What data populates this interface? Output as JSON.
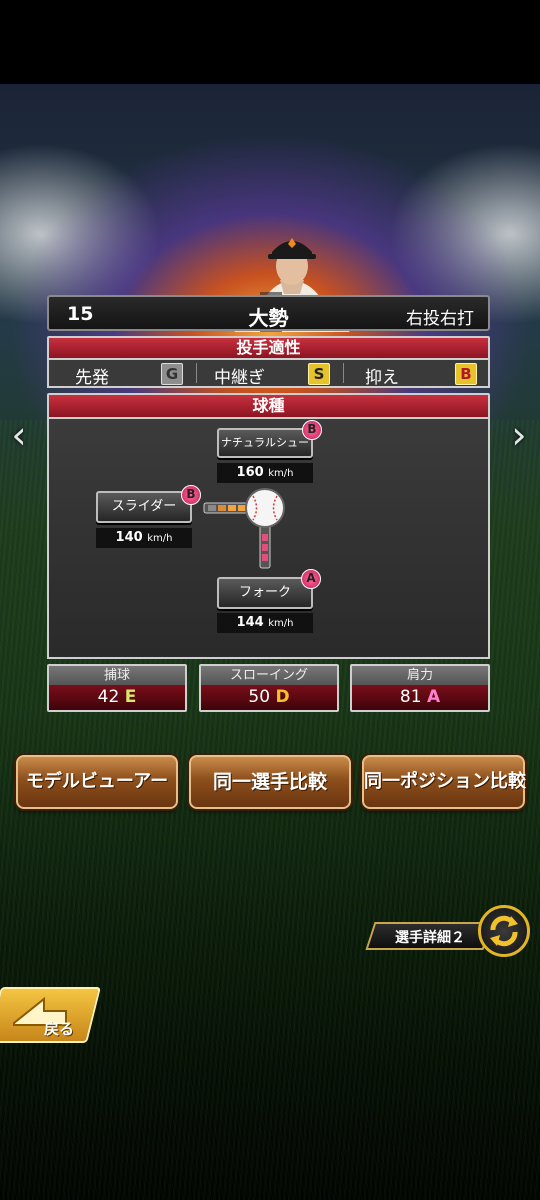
{
  "player": {
    "number": "15",
    "name": "大勢",
    "handedness": "右投右打"
  },
  "aptitude": {
    "title": "投手適性",
    "roles": [
      {
        "label": "先発",
        "rank": "G",
        "color": "#9a9a9a"
      },
      {
        "label": "中継ぎ",
        "rank": "S",
        "color": "#e6c22b"
      },
      {
        "label": "抑え",
        "rank": "B",
        "color": "#e6c22b"
      }
    ]
  },
  "pitches": {
    "title": "球種",
    "up": {
      "name": "ナチュラルシュート",
      "rank": "B",
      "speed": "160",
      "unit": "km/h"
    },
    "left": {
      "name": "スライダー",
      "rank": "B",
      "speed": "140",
      "unit": "km/h"
    },
    "down": {
      "name": "フォーク",
      "rank": "A",
      "speed": "144",
      "unit": "km/h"
    }
  },
  "fielding": [
    {
      "label": "捕球",
      "value": "42",
      "rank": "E",
      "rank_color": "#d8e86a"
    },
    {
      "label": "スローイング",
      "value": "50",
      "rank": "D",
      "rank_color": "#f2c22c"
    },
    {
      "label": "肩力",
      "value": "81",
      "rank": "A",
      "rank_color": "#ff7fd0"
    }
  ],
  "buttons": {
    "model_viewer": "モデルビューアー",
    "same_player": "同一選手比較",
    "same_position": "同一ポジション比較"
  },
  "detail_tab": "選手詳細２",
  "back_label": "戻る"
}
